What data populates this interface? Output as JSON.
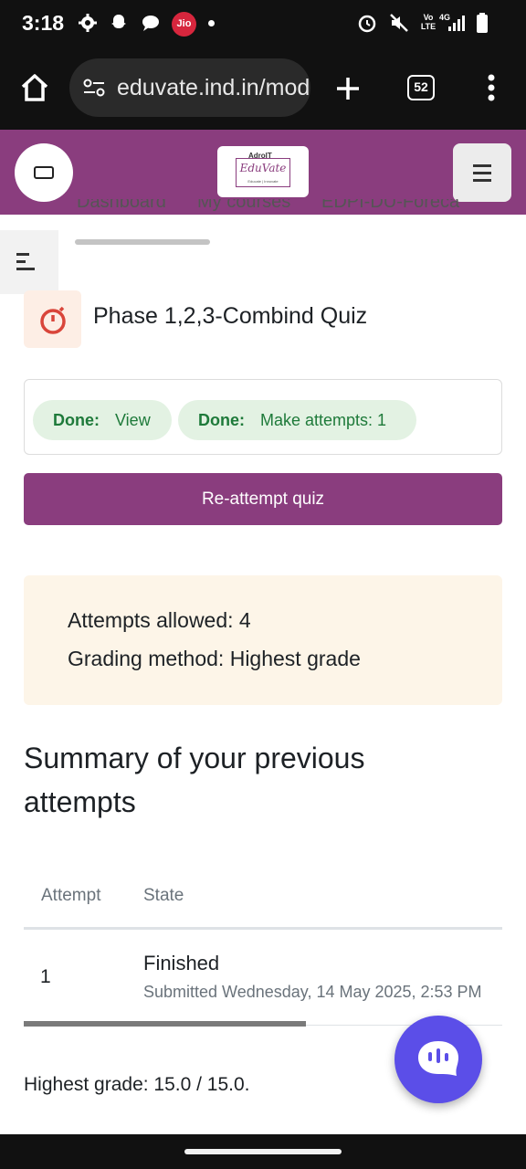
{
  "status_bar": {
    "time": "3:18",
    "carrier_badge": "Jio",
    "network_label_top": "Vo",
    "network_label_bottom": "LTE",
    "network_gen": "4G"
  },
  "browser": {
    "url": "eduvate.ind.in/mod/quiz",
    "tab_count": "52"
  },
  "header": {
    "logo_top": "AdroIT",
    "logo_brand": "EduVate",
    "logo_tagline": "Educate | Innovate"
  },
  "nav_tabs": [
    "Dashboard",
    "My courses",
    "EDPI-DU-Foreca"
  ],
  "quiz": {
    "title": "Phase 1,2,3-Combind Quiz",
    "completion": [
      {
        "status": "Done:",
        "label": "View"
      },
      {
        "status": "Done:",
        "label": "Make attempts: 1"
      }
    ],
    "reattempt_label": "Re-attempt quiz",
    "attempts_allowed": "Attempts allowed: 4",
    "grading_method": "Grading method: Highest grade",
    "summary_line1": "Summary of your previous",
    "summary_line2": "attempts",
    "table": {
      "headers": [
        "Attempt",
        "State"
      ],
      "rows": [
        {
          "attempt": "1",
          "state": "Finished",
          "submitted": "Submitted Wednesday, 14 May 2025, 2:53 PM"
        }
      ]
    },
    "highest_grade": "Highest grade: 15.0 / 15.0."
  },
  "colors": {
    "brand": "#8a3d7e",
    "done_pill_bg": "#e3f2e3",
    "done_text": "#1e7a3a",
    "info_bg": "#fdf5e8",
    "fab": "#5b4ee8"
  },
  "icons": [
    "home-icon",
    "site-settings-icon",
    "new-tab-icon",
    "overflow-menu-icon",
    "stopwatch-icon",
    "chat-icon"
  ]
}
